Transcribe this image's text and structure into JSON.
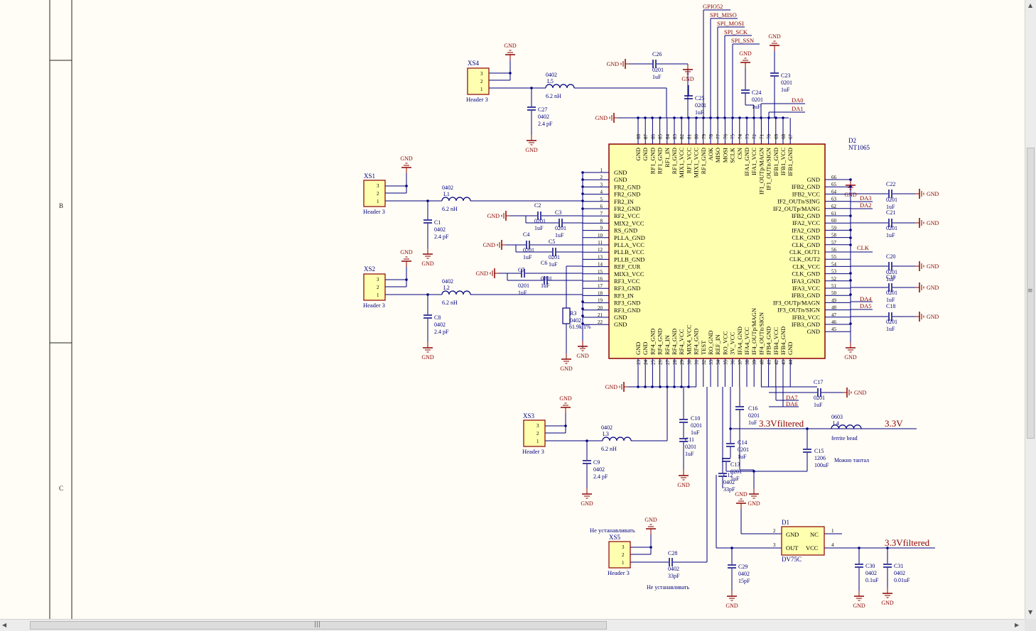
{
  "frame": {
    "zones": [
      "B",
      "C"
    ]
  },
  "ic": {
    "ref": "D2",
    "part": "NT1065",
    "top_pins": [
      {
        "n": "88",
        "name": "GND"
      },
      {
        "n": "87",
        "name": "GND"
      },
      {
        "n": "86",
        "name": "RF1_GND"
      },
      {
        "n": "85",
        "name": "RF1_GND"
      },
      {
        "n": "84",
        "name": "RF1_IN"
      },
      {
        "n": "83",
        "name": "RF1_GND"
      },
      {
        "n": "82",
        "name": "MIX1_VCC"
      },
      {
        "n": "81",
        "name": "RF1_VCC"
      },
      {
        "n": "80",
        "name": "MIX1_VCC"
      },
      {
        "n": "79",
        "name": "RF1_GND"
      },
      {
        "n": "78",
        "name": "AOK"
      },
      {
        "n": "77",
        "name": "MISO"
      },
      {
        "n": "76",
        "name": "MOSI"
      },
      {
        "n": "75",
        "name": "SCLK"
      },
      {
        "n": "74",
        "name": "CSN"
      },
      {
        "n": "73",
        "name": "IFA1_GND"
      },
      {
        "n": "72",
        "name": "IFA1_VCC"
      },
      {
        "n": "71",
        "name": "IF1_OUTp/MAGN"
      },
      {
        "n": "70",
        "name": "IF1_OUTn/SIGN"
      },
      {
        "n": "69",
        "name": "IFB1_GND"
      },
      {
        "n": "68",
        "name": "IFB1_VCC"
      },
      {
        "n": "67",
        "name": "IFB1_GND"
      }
    ],
    "left_pins": [
      {
        "n": "1",
        "name": "GND"
      },
      {
        "n": "2",
        "name": "GND"
      },
      {
        "n": "3",
        "name": "FR2_GND"
      },
      {
        "n": "4",
        "name": "FR2_GND"
      },
      {
        "n": "5",
        "name": "FR2_IN"
      },
      {
        "n": "6",
        "name": "FR2_GND"
      },
      {
        "n": "7",
        "name": "RF2_VCC"
      },
      {
        "n": "8",
        "name": "MIX2_VCC"
      },
      {
        "n": "9",
        "name": "RS_GND"
      },
      {
        "n": "10",
        "name": "PLLA_GND"
      },
      {
        "n": "11",
        "name": "PLLA_VCC"
      },
      {
        "n": "12",
        "name": "PLLB_VCC"
      },
      {
        "n": "13",
        "name": "PLLB_GND"
      },
      {
        "n": "14",
        "name": "REF_CUR"
      },
      {
        "n": "15",
        "name": "MIX3_VCC"
      },
      {
        "n": "16",
        "name": "RF3_VCC"
      },
      {
        "n": "17",
        "name": "RF3_GND"
      },
      {
        "n": "18",
        "name": "RF3_IN"
      },
      {
        "n": "19",
        "name": "RF3_GND"
      },
      {
        "n": "20",
        "name": "RF3_GND"
      },
      {
        "n": "21",
        "name": "GND"
      },
      {
        "n": "22",
        "name": "GND"
      }
    ],
    "right_pins": [
      {
        "n": "66",
        "name": "GND"
      },
      {
        "n": "65",
        "name": "IFB2_GND"
      },
      {
        "n": "64",
        "name": "IFB2_VCC"
      },
      {
        "n": "63",
        "name": "IF2_OUTn/SING"
      },
      {
        "n": "62",
        "name": "IF2_OUTp/MANG"
      },
      {
        "n": "61",
        "name": "IFB2_GND"
      },
      {
        "n": "60",
        "name": "IFA2_VCC"
      },
      {
        "n": "59",
        "name": "IFA2_GND"
      },
      {
        "n": "58",
        "name": "CLK_GND"
      },
      {
        "n": "57",
        "name": "CLK_GND"
      },
      {
        "n": "56",
        "name": "CLK_OUT1"
      },
      {
        "n": "55",
        "name": "CLK_OUT2"
      },
      {
        "n": "54",
        "name": "CLK_VCC"
      },
      {
        "n": "53",
        "name": "CLK_GND"
      },
      {
        "n": "52",
        "name": "IFA3_GND"
      },
      {
        "n": "51",
        "name": "IFA3_VCC"
      },
      {
        "n": "50",
        "name": "IFB3_GND"
      },
      {
        "n": "49",
        "name": "IF3_OUTp/MAGN"
      },
      {
        "n": "48",
        "name": "IF3_OUTn/SIGN"
      },
      {
        "n": "47",
        "name": "IFB3_VCC"
      },
      {
        "n": "46",
        "name": "IFB3_GND"
      },
      {
        "n": "45",
        "name": "GND"
      }
    ],
    "bottom_pins": [
      {
        "n": "23",
        "name": "GND"
      },
      {
        "n": "24",
        "name": "GND"
      },
      {
        "n": "25",
        "name": "RF4_GND"
      },
      {
        "n": "26",
        "name": "RF4_GND"
      },
      {
        "n": "27",
        "name": "RF4_IN"
      },
      {
        "n": "28",
        "name": "RF4_GND"
      },
      {
        "n": "29",
        "name": "RF4_VCC"
      },
      {
        "n": "30",
        "name": "MIX4_VCC"
      },
      {
        "n": "31",
        "name": "RF4_GND"
      },
      {
        "n": "32",
        "name": "TEST"
      },
      {
        "n": "33",
        "name": "RO_GND"
      },
      {
        "n": "34",
        "name": "REF_IN"
      },
      {
        "n": "35",
        "name": "RO_VCC"
      },
      {
        "n": "36",
        "name": "3V_VCC"
      },
      {
        "n": "37",
        "name": "IFA4_GND"
      },
      {
        "n": "38",
        "name": "IFA4_VCC"
      },
      {
        "n": "39",
        "name": "IF4_OUTp/MAGN"
      },
      {
        "n": "40",
        "name": "IF4_OUTn/SIGN"
      },
      {
        "n": "41",
        "name": "IFB4_GND"
      },
      {
        "n": "42",
        "name": "IFB4_VCC"
      },
      {
        "n": "43",
        "name": "IFB4_GND"
      },
      {
        "n": "44",
        "name": "GND"
      }
    ]
  },
  "nets": {
    "gnd": "GND",
    "gpio": "GPIO52",
    "spi_miso": "SPI_MISO",
    "spi_mosi": "SPI_MOSI",
    "spi_sck": "SPI_SCK",
    "spi_ssn": "SPI_SSN",
    "da0": "DA0",
    "da1": "DA1",
    "da2": "DA2",
    "da3": "DA3",
    "da4": "DA4",
    "da5": "DA5",
    "da6": "DA6",
    "da7": "DA7",
    "clk": "CLK",
    "v33f": "3.3Vfiltered",
    "v33": "3.3V"
  },
  "headers": [
    {
      "ref": "XS4",
      "label": "Header 3"
    },
    {
      "ref": "XS1",
      "label": "Header 3"
    },
    {
      "ref": "XS2",
      "label": "Header 3"
    },
    {
      "ref": "XS3",
      "label": "Header 3"
    },
    {
      "ref": "XS5",
      "label": "Header 3",
      "note": "Не устанавливать"
    }
  ],
  "pin_nums": [
    "3",
    "2",
    "1"
  ],
  "inductors": [
    {
      "ref": "L5",
      "pkg": "0402",
      "val": "6.2 nH"
    },
    {
      "ref": "L1",
      "pkg": "0402",
      "val": "6.2 nH"
    },
    {
      "ref": "L2",
      "pkg": "0402",
      "val": "6.2 nH"
    },
    {
      "ref": "L3",
      "pkg": "0402",
      "val": "6.2 nH"
    },
    {
      "ref": "L4",
      "pkg": "0603",
      "val": "ferrite bead"
    }
  ],
  "caps": {
    "c1": {
      "ref": "C1",
      "pkg": "0402",
      "val": "2.4 pF"
    },
    "c8": {
      "ref": "C8",
      "pkg": "0402",
      "val": "2.4 pF"
    },
    "c9": {
      "ref": "C9",
      "pkg": "0402",
      "val": "2.4 pF"
    },
    "c27": {
      "ref": "C27",
      "pkg": "0402",
      "val": "2.4 pF"
    },
    "c2": {
      "ref": "C2",
      "pkg": "0201",
      "val": "1uF"
    },
    "c3": {
      "ref": "C3",
      "pkg": "0201",
      "val": "1uF"
    },
    "c4": {
      "ref": "C4",
      "pkg": "0201",
      "val": "1uF"
    },
    "c5": {
      "ref": "C5",
      "pkg": "0201",
      "val": "1uF"
    },
    "c6": {
      "ref": "C6",
      "pkg": "0201",
      "val": "1uF"
    },
    "c7": {
      "ref": "C7",
      "pkg": "0201",
      "val": "1uF"
    },
    "c10": {
      "ref": "C10",
      "pkg": "0201",
      "val": "1uF"
    },
    "c11": {
      "ref": "C11",
      "pkg": "0201",
      "val": "1uF"
    },
    "c12": {
      "ref": "C12",
      "pkg": "0402",
      "val": "33pF"
    },
    "c13": {
      "ref": "C13",
      "pkg": "0201",
      "val": "1uF"
    },
    "c14": {
      "ref": "C14",
      "pkg": "0201",
      "val": "1uF"
    },
    "c15": {
      "ref": "C15",
      "pkg": "1206",
      "val": "100uF",
      "note": "Можно тантал"
    },
    "c16": {
      "ref": "C16",
      "pkg": "0201",
      "val": "1uF"
    },
    "c17": {
      "ref": "C17",
      "pkg": "0201",
      "val": "1uF"
    },
    "c18": {
      "ref": "C18",
      "pkg": "0201",
      "val": "1uF"
    },
    "c19": {
      "ref": "C19",
      "pkg": "0201",
      "val": "1uF"
    },
    "c20": {
      "ref": "C20",
      "pkg": "0201",
      "val": "1uF"
    },
    "c21": {
      "ref": "C21",
      "pkg": "0201",
      "val": "1uF"
    },
    "c22": {
      "ref": "C22",
      "pkg": "0201",
      "val": "1uF"
    },
    "c23": {
      "ref": "C23",
      "pkg": "0201",
      "val": "1uF"
    },
    "c24": {
      "ref": "C24",
      "pkg": "0201",
      "val": "1uF"
    },
    "c25": {
      "ref": "C25",
      "pkg": "0201",
      "val": "1uF"
    },
    "c26": {
      "ref": "C26",
      "pkg": "0201",
      "val": "1uF"
    },
    "c28": {
      "ref": "C28",
      "pkg": "0402",
      "val": "33pF",
      "note": "Не устанавливать"
    },
    "c29": {
      "ref": "C29",
      "pkg": "0402",
      "val": "15pF"
    },
    "c30": {
      "ref": "C30",
      "pkg": "0402",
      "val": "0.1uF"
    },
    "c31": {
      "ref": "C31",
      "pkg": "0402",
      "val": "0.01uF"
    }
  },
  "resistor": {
    "ref": "R3",
    "pkg": "0402",
    "val": "61.9k 1%"
  },
  "regulator": {
    "ref": "D1",
    "part": "DV75C",
    "pins": {
      "gnd": "GND",
      "nc": "NC",
      "out": "OUT",
      "vcc": "VCC"
    },
    "nums": [
      "2",
      "1",
      "3",
      "4"
    ]
  }
}
